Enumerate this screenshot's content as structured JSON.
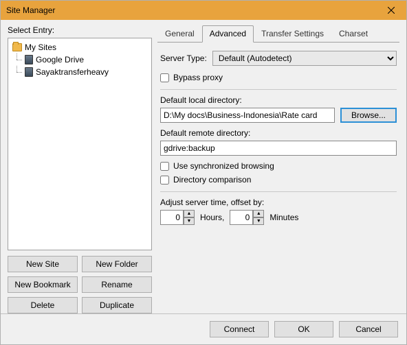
{
  "window": {
    "title": "Site Manager"
  },
  "left": {
    "select_entry": "Select Entry:",
    "root": "My Sites",
    "items": [
      "Google Drive",
      "Sayaktransferheavy"
    ],
    "buttons": {
      "new_site": "New Site",
      "new_folder": "New Folder",
      "new_bookmark": "New Bookmark",
      "rename": "Rename",
      "delete": "Delete",
      "duplicate": "Duplicate"
    }
  },
  "tabs": {
    "general": "General",
    "advanced": "Advanced",
    "transfer": "Transfer Settings",
    "charset": "Charset"
  },
  "advanced": {
    "server_type_label": "Server Type:",
    "server_type_value": "Default (Autodetect)",
    "bypass_proxy": "Bypass proxy",
    "default_local_label": "Default local directory:",
    "default_local_value": "D:\\My docs\\Business-Indonesia\\Rate card",
    "browse": "Browse...",
    "default_remote_label": "Default remote directory:",
    "default_remote_value": "gdrive:backup",
    "sync_browsing": "Use synchronized browsing",
    "dir_comparison": "Directory comparison",
    "adjust_time_label": "Adjust server time, offset by:",
    "hours_value": "0",
    "hours_label": "Hours,",
    "minutes_value": "0",
    "minutes_label": "Minutes"
  },
  "footer": {
    "connect": "Connect",
    "ok": "OK",
    "cancel": "Cancel"
  }
}
